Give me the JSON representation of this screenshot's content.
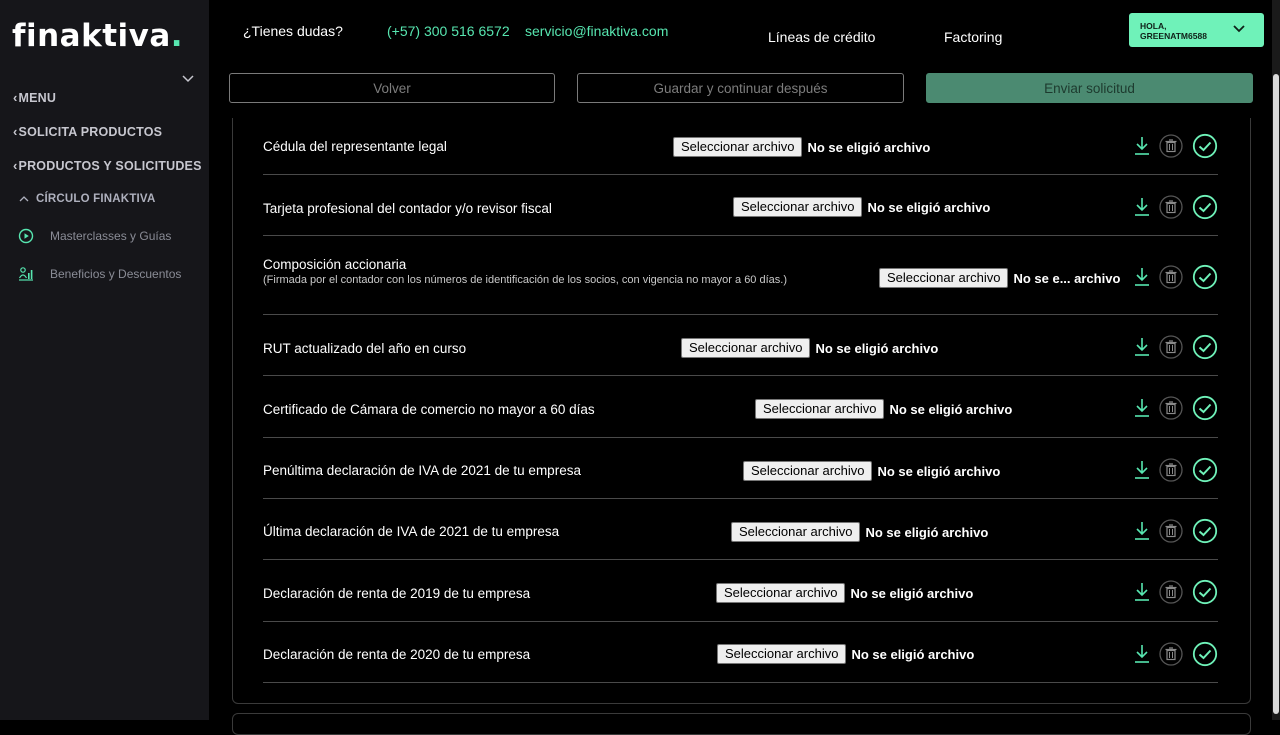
{
  "brand": {
    "logo_text": "finaktiva",
    "logo_dot": "."
  },
  "header": {
    "question": "¿Tienes dudas?",
    "phone": "(+57) 300 516 6572",
    "email": "servicio@finaktiva.com",
    "nav": [
      "Líneas de crédito",
      "Factoring"
    ],
    "user_greeting": "HOLA,",
    "user_name": "GREENATM6588"
  },
  "sidebar": {
    "menu": "MENU",
    "solicita": "SOLICITA PRODUCTOS",
    "productos": "PRODUCTOS Y SOLICITUDES",
    "circulo": "CÍRCULO FINAKTIVA",
    "masterclasses": "Masterclasses y Guías",
    "beneficios": "Beneficios y Descuentos"
  },
  "toolbar": {
    "back": "Volver",
    "save_later": "Guardar y continuar después",
    "send": "Enviar solicitud"
  },
  "file_button_label": "Seleccionar archivo",
  "documents": [
    {
      "name": "Cédula del representante legal",
      "note": "",
      "status": "No se eligió archivo"
    },
    {
      "name": "Tarjeta profesional del contador y/o revisor fiscal",
      "note": "",
      "status": "No se eligió archivo"
    },
    {
      "name": "Composición accionaria",
      "note": "(Firmada por el contador con los números de identificación de los socios, con vigencia no mayor a 60 días.)",
      "status": "No se e... archivo"
    },
    {
      "name": "RUT actualizado del año en curso",
      "note": "",
      "status": "No se eligió archivo"
    },
    {
      "name": "Certificado de Cámara de comercio no mayor a 60 días",
      "note": "",
      "status": "No se eligió archivo"
    },
    {
      "name": "Penúltima declaración de IVA de 2021 de tu empresa",
      "note": "",
      "status": "No se eligió archivo"
    },
    {
      "name": "Última declaración de IVA de 2021 de tu empresa",
      "note": "",
      "status": "No se eligió archivo"
    },
    {
      "name": "Declaración de renta de 2019 de tu empresa",
      "note": "",
      "status": "No se eligió archivo"
    },
    {
      "name": "Declaración de renta de 2020 de tu empresa",
      "note": "",
      "status": "No se eligió archivo"
    }
  ],
  "colors": {
    "accent": "#57e6b0",
    "sidebar_bg": "#16161a",
    "primary_button": "#4b8a71"
  }
}
